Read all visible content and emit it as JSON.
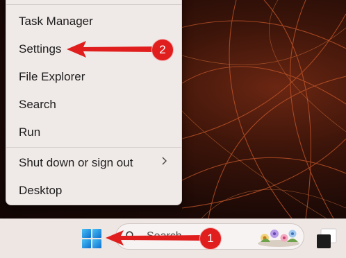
{
  "menu": {
    "items": [
      {
        "label": "Task Manager"
      },
      {
        "label": "Settings"
      },
      {
        "label": "File Explorer"
      },
      {
        "label": "Search"
      },
      {
        "label": "Run"
      },
      {
        "label": "Shut down or sign out",
        "has_submenu": true
      },
      {
        "label": "Desktop"
      }
    ],
    "submenu_chevron": ">"
  },
  "taskbar": {
    "start_icon": "windows-logo-icon",
    "search_placeholder": "Search",
    "search_icon": "search-icon"
  },
  "annotations": [
    {
      "number": "1",
      "points_to": "start-button"
    },
    {
      "number": "2",
      "points_to": "Settings"
    }
  ],
  "colors": {
    "annotation_red": "#e01e1e",
    "menu_bg": "#efe9e7",
    "taskbar_bg": "#eee6e3"
  }
}
